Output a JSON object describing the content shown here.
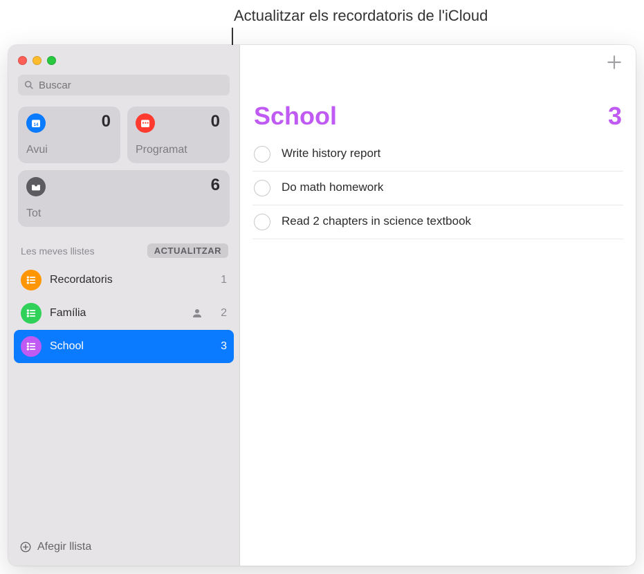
{
  "annotation": "Actualitzar els recordatoris de l'iCloud",
  "search": {
    "placeholder": "Buscar"
  },
  "smartCards": {
    "today": {
      "label": "Avui",
      "count": "0"
    },
    "scheduled": {
      "label": "Programat",
      "count": "0"
    },
    "all": {
      "label": "Tot",
      "count": "6"
    }
  },
  "section": {
    "title": "Les meves llistes",
    "upgrade": "ACTUALITZAR"
  },
  "lists": [
    {
      "label": "Recordatoris",
      "count": "1",
      "shared": false,
      "color": "orange",
      "selected": false
    },
    {
      "label": "Família",
      "count": "2",
      "shared": true,
      "color": "greenc",
      "selected": false
    },
    {
      "label": "School",
      "count": "3",
      "shared": false,
      "color": "purple",
      "selected": true
    }
  ],
  "footer": {
    "addList": "Afegir llista"
  },
  "main": {
    "title": "School",
    "count": "3",
    "reminders": [
      {
        "text": "Write history report"
      },
      {
        "text": "Do math homework"
      },
      {
        "text": "Read 2 chapters in science textbook"
      }
    ]
  }
}
